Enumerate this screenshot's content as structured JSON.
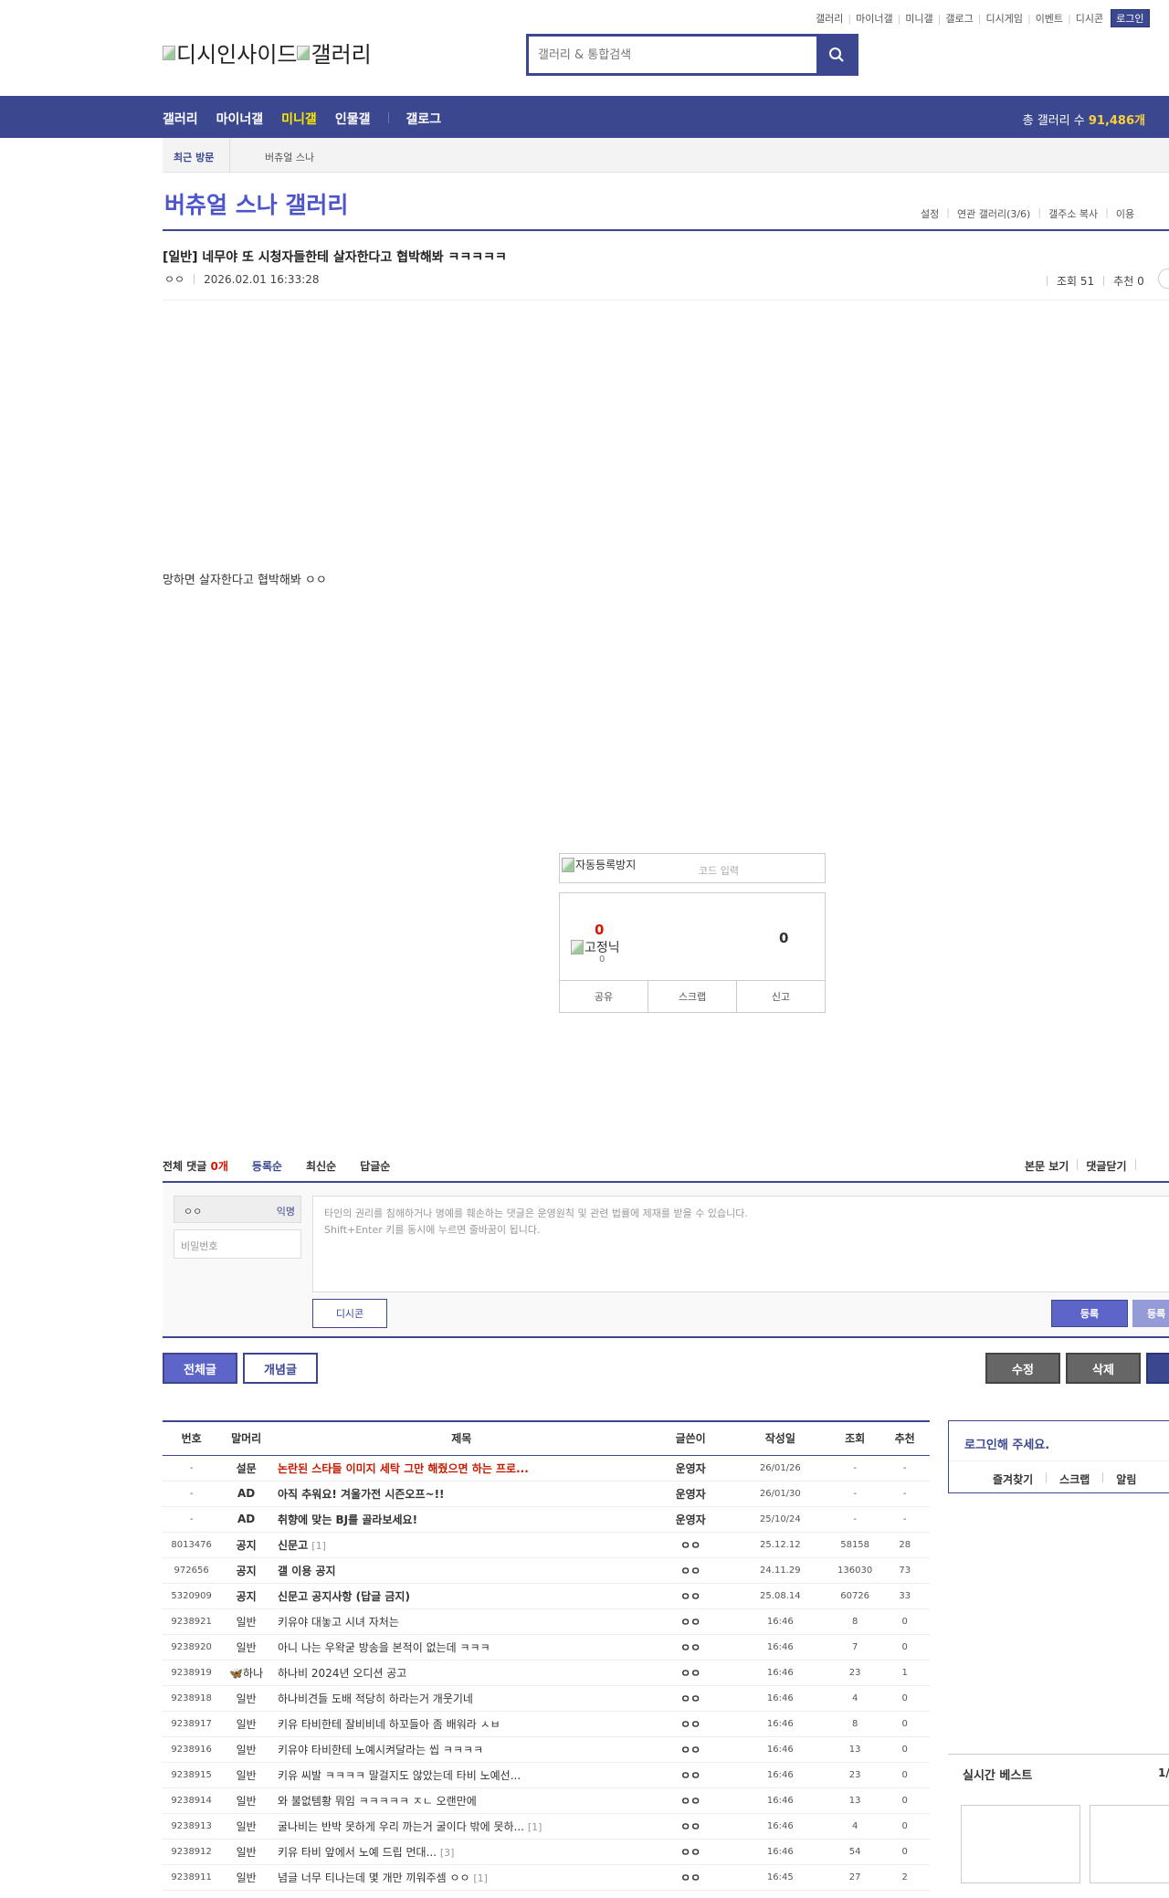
{
  "header": {
    "util_links": [
      "갤러리",
      "마이너갤",
      "미니갤",
      "갤로그",
      "디시게임",
      "이벤트",
      "디시콘"
    ],
    "login_label": "로그인",
    "logo_alt_1": "디시인사이드",
    "logo_alt_2": "갤러리",
    "search_placeholder": "갤러리 & 통합검색"
  },
  "nav": {
    "items": [
      "갤러리",
      "마이너갤",
      "미니갤",
      "인물갤",
      "갤로그"
    ],
    "active_index": 2,
    "total_label": "총 갤러리 수",
    "total_value": "91,486개"
  },
  "recent": {
    "label": "최근 방문",
    "item": "버츄얼 스나"
  },
  "gallery": {
    "title": "버츄얼 스나 갤러리",
    "links": [
      "설정",
      "연관 갤러리(3/6)",
      "갤주소 복사",
      "이용"
    ]
  },
  "post": {
    "title": "[일반] 네무야 또 시청자들한테 살자한다고 협박해봐 ㅋㅋㅋㅋㅋ",
    "author": "ㅇㅇ",
    "date": "2026.02.01 16:33:28",
    "views": "조회 51",
    "recommend": "추천 0",
    "body": "망하면 살자한다고 협박해봐 ㅇㅇ"
  },
  "captcha": {
    "alt": "자동등록방지",
    "placeholder": "코드 입력"
  },
  "recommend_box": {
    "up_count": "0",
    "fixed_alt": "고정닉",
    "fixed_count": "0",
    "down_count": "0",
    "buttons": [
      "공유",
      "스크랩",
      "신고"
    ]
  },
  "comments": {
    "label": "전체 댓글",
    "count": "0개",
    "sort_tabs": [
      "등록순",
      "최신순",
      "답글순"
    ],
    "right_links": [
      "본문 보기",
      "댓글닫기"
    ],
    "nick": "ㅇㅇ",
    "anon": "익명",
    "password_placeholder": "비밀번호",
    "textarea_line1": "타인의 권리를 침해하거나 명예를 훼손하는 댓글은 운영원칙 및 관련 법률에 제재를 받을 수 있습니다.",
    "textarea_line2": "Shift+Enter 키를 동시에 누르면 줄바꿈이 됩니다.",
    "dccon": "디시콘",
    "submit": "등록",
    "submit2": "등록"
  },
  "list_buttons": {
    "all": "전체글",
    "concept": "개념글",
    "edit": "수정",
    "delete": "삭제"
  },
  "table": {
    "headers": [
      "번호",
      "말머리",
      "제목",
      "글쓴이",
      "작성일",
      "조회",
      "추천"
    ],
    "rows": [
      {
        "num": "-",
        "subject": "설문",
        "title": "논란된 스타들 이미지 세탁 그만 해줬으면 하는 프로...",
        "reply": "",
        "writer": "운영자",
        "date": "26/01/26",
        "views": "-",
        "rec": "-",
        "style": "red"
      },
      {
        "num": "-",
        "subject": "AD",
        "title": "아직 추워요! 겨울가전 시즌오프~!!",
        "reply": "",
        "writer": "운영자",
        "date": "26/01/30",
        "views": "-",
        "rec": "-",
        "style": "bold"
      },
      {
        "num": "-",
        "subject": "AD",
        "title": "취향에 맞는 BJ를 골라보세요!",
        "reply": "",
        "writer": "운영자",
        "date": "25/10/24",
        "views": "-",
        "rec": "-",
        "style": "bold"
      },
      {
        "num": "8013476",
        "subject": "공지",
        "title": "신문고",
        "reply": "[1]",
        "writer": "ㅇㅇ",
        "date": "25.12.12",
        "views": "58158",
        "rec": "28",
        "style": "bold"
      },
      {
        "num": "972656",
        "subject": "공지",
        "title": "갤 이용 공지",
        "reply": "",
        "writer": "ㅇㅇ",
        "date": "24.11.29",
        "views": "136030",
        "rec": "73",
        "style": "bold"
      },
      {
        "num": "5320909",
        "subject": "공지",
        "title": "신문고 공지사항 (답글 금지)",
        "reply": "",
        "writer": "ㅇㅇ",
        "date": "25.08.14",
        "views": "60726",
        "rec": "33",
        "style": "bold"
      },
      {
        "num": "9238921",
        "subject": "일반",
        "title": "키유야 대놓고 시녀 자처는",
        "reply": "",
        "writer": "ㅇㅇ",
        "date": "16:46",
        "views": "8",
        "rec": "0",
        "style": ""
      },
      {
        "num": "9238920",
        "subject": "일반",
        "title": "아니 나는 우왁굳 방송을 본적이 없는데 ㅋㅋㅋ",
        "reply": "",
        "writer": "ㅇㅇ",
        "date": "16:46",
        "views": "7",
        "rec": "0",
        "style": ""
      },
      {
        "num": "9238919",
        "subject": "🦋하나",
        "title": "하나비 2024년 오디션 공고",
        "reply": "",
        "writer": "ㅇㅇ",
        "date": "16:46",
        "views": "23",
        "rec": "1",
        "style": ""
      },
      {
        "num": "9238918",
        "subject": "일반",
        "title": "하나비견들 도배 적당히 하라는거 개웃기네",
        "reply": "",
        "writer": "ㅇㅇ",
        "date": "16:46",
        "views": "4",
        "rec": "0",
        "style": ""
      },
      {
        "num": "9238917",
        "subject": "일반",
        "title": "키유 타비한테 잘비비네 하꼬들아 좀 배워라 ㅅㅂ",
        "reply": "",
        "writer": "ㅇㅇ",
        "date": "16:46",
        "views": "8",
        "rec": "0",
        "style": ""
      },
      {
        "num": "9238916",
        "subject": "일반",
        "title": "키유야 타비한테 노예시켜달라는 씹 ㅋㅋㅋㅋ",
        "reply": "",
        "writer": "ㅇㅇ",
        "date": "16:46",
        "views": "13",
        "rec": "0",
        "style": ""
      },
      {
        "num": "9238915",
        "subject": "일반",
        "title": "키유 씨발 ㅋㅋㅋㅋ 말걸지도 않았는데 타비 노예선...",
        "reply": "",
        "writer": "ㅇㅇ",
        "date": "16:46",
        "views": "23",
        "rec": "0",
        "style": ""
      },
      {
        "num": "9238914",
        "subject": "일반",
        "title": "와 불없템황 뭐임 ㅋㅋㅋㅋㅋ ㅈㄴ 오랜만에",
        "reply": "",
        "writer": "ㅇㅇ",
        "date": "16:46",
        "views": "13",
        "rec": "0",
        "style": ""
      },
      {
        "num": "9238913",
        "subject": "일반",
        "title": "굴나비는 반박 못하게 우리 까는거 굴이다 밖에 못하...",
        "reply": "[1]",
        "writer": "ㅇㅇ",
        "date": "16:46",
        "views": "4",
        "rec": "0",
        "style": ""
      },
      {
        "num": "9238912",
        "subject": "일반",
        "title": "키유 타비 앞에서 노예 드립 먼대...",
        "reply": "[3]",
        "writer": "ㅇㅇ",
        "date": "16:46",
        "views": "54",
        "rec": "0",
        "style": ""
      },
      {
        "num": "9238911",
        "subject": "일반",
        "title": "념글 너무 티나는데 몇 개만 끼워주셈 ㅇㅇ",
        "reply": "[1]",
        "writer": "ㅇㅇ",
        "date": "16:45",
        "views": "27",
        "rec": "2",
        "style": ""
      }
    ]
  },
  "side": {
    "login_title": "로그인해 주세요.",
    "login_links": [
      "즐겨찾기",
      "스크랩",
      "알림"
    ],
    "best_title": "실시간 베스트",
    "best_page": "1/"
  },
  "colors": {
    "brand": "#3b4890",
    "accent_title": "#4c55cc",
    "nav_active": "#fce700",
    "red": "#c41a00"
  }
}
